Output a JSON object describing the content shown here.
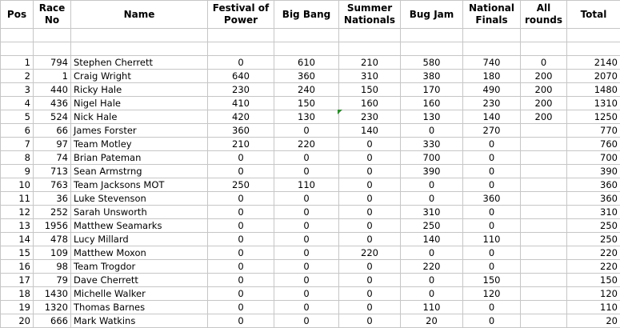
{
  "headers": {
    "pos": "Pos",
    "race_no": "Race No",
    "name": "Name",
    "festival_of_power": "Festival of Power",
    "big_bang": "Big Bang",
    "summer_nationals": "Summer Nationals",
    "bug_jam": "Bug Jam",
    "national_finals": "National Finals",
    "all_rounds": "All rounds",
    "total": "Total"
  },
  "rows": [
    {
      "pos": "1",
      "race_no": "794",
      "name": "Stephen Cherrett",
      "festival_of_power": "0",
      "big_bang": "610",
      "summer_nationals": "210",
      "bug_jam": "580",
      "national_finals": "740",
      "all_rounds": "0",
      "total": "2140"
    },
    {
      "pos": "2",
      "race_no": "1",
      "name": "Craig Wright",
      "festival_of_power": "640",
      "big_bang": "360",
      "summer_nationals": "310",
      "bug_jam": "380",
      "national_finals": "180",
      "all_rounds": "200",
      "total": "2070"
    },
    {
      "pos": "3",
      "race_no": "440",
      "name": "Ricky Hale",
      "festival_of_power": "230",
      "big_bang": "240",
      "summer_nationals": "150",
      "bug_jam": "170",
      "national_finals": "490",
      "all_rounds": "200",
      "total": "1480"
    },
    {
      "pos": "4",
      "race_no": "436",
      "name": "Nigel Hale",
      "festival_of_power": "410",
      "big_bang": "150",
      "summer_nationals": "160",
      "bug_jam": "160",
      "national_finals": "230",
      "all_rounds": "200",
      "total": "1310"
    },
    {
      "pos": "5",
      "race_no": "524",
      "name": "Nick Hale",
      "festival_of_power": "420",
      "big_bang": "130",
      "summer_nationals": "230",
      "bug_jam": "130",
      "national_finals": "140",
      "all_rounds": "200",
      "total": "1250"
    },
    {
      "pos": "6",
      "race_no": "66",
      "name": "James Forster",
      "festival_of_power": "360",
      "big_bang": "0",
      "summer_nationals": "140",
      "bug_jam": "0",
      "national_finals": "270",
      "all_rounds": "",
      "total": "770"
    },
    {
      "pos": "7",
      "race_no": "97",
      "name": "Team Motley",
      "festival_of_power": "210",
      "big_bang": "220",
      "summer_nationals": "0",
      "bug_jam": "330",
      "national_finals": "0",
      "all_rounds": "",
      "total": "760"
    },
    {
      "pos": "8",
      "race_no": "74",
      "name": "Brian Pateman",
      "festival_of_power": "0",
      "big_bang": "0",
      "summer_nationals": "0",
      "bug_jam": "700",
      "national_finals": "0",
      "all_rounds": "",
      "total": "700"
    },
    {
      "pos": "9",
      "race_no": "713",
      "name": "Sean Armstrng",
      "festival_of_power": "0",
      "big_bang": "0",
      "summer_nationals": "0",
      "bug_jam": "390",
      "national_finals": "0",
      "all_rounds": "",
      "total": "390"
    },
    {
      "pos": "10",
      "race_no": "763",
      "name": "Team Jacksons MOT",
      "festival_of_power": "250",
      "big_bang": "110",
      "summer_nationals": "0",
      "bug_jam": "0",
      "national_finals": "0",
      "all_rounds": "",
      "total": "360"
    },
    {
      "pos": "11",
      "race_no": "36",
      "name": "Luke Stevenson",
      "festival_of_power": "0",
      "big_bang": "0",
      "summer_nationals": "0",
      "bug_jam": "0",
      "national_finals": "360",
      "all_rounds": "",
      "total": "360"
    },
    {
      "pos": "12",
      "race_no": "252",
      "name": "Sarah Unsworth",
      "festival_of_power": "0",
      "big_bang": "0",
      "summer_nationals": "0",
      "bug_jam": "310",
      "national_finals": "0",
      "all_rounds": "",
      "total": "310"
    },
    {
      "pos": "13",
      "race_no": "1956",
      "name": "Matthew Seamarks",
      "festival_of_power": "0",
      "big_bang": "0",
      "summer_nationals": "0",
      "bug_jam": "250",
      "national_finals": "0",
      "all_rounds": "",
      "total": "250"
    },
    {
      "pos": "14",
      "race_no": "478",
      "name": "Lucy Millard",
      "festival_of_power": "0",
      "big_bang": "0",
      "summer_nationals": "0",
      "bug_jam": "140",
      "national_finals": "110",
      "all_rounds": "",
      "total": "250"
    },
    {
      "pos": "15",
      "race_no": "109",
      "name": "Matthew Moxon",
      "festival_of_power": "0",
      "big_bang": "0",
      "summer_nationals": "220",
      "bug_jam": "0",
      "national_finals": "0",
      "all_rounds": "",
      "total": "220"
    },
    {
      "pos": "16",
      "race_no": "98",
      "name": "Team Trogdor",
      "festival_of_power": "0",
      "big_bang": "0",
      "summer_nationals": "0",
      "bug_jam": "220",
      "national_finals": "0",
      "all_rounds": "",
      "total": "220"
    },
    {
      "pos": "17",
      "race_no": "79",
      "name": "Dave Cherrett",
      "festival_of_power": "0",
      "big_bang": "0",
      "summer_nationals": "0",
      "bug_jam": "0",
      "national_finals": "150",
      "all_rounds": "",
      "total": "150"
    },
    {
      "pos": "18",
      "race_no": "1430",
      "name": "Michelle Walker",
      "festival_of_power": "0",
      "big_bang": "0",
      "summer_nationals": "0",
      "bug_jam": "0",
      "national_finals": "120",
      "all_rounds": "",
      "total": "120"
    },
    {
      "pos": "19",
      "race_no": "1320",
      "name": "Thomas Barnes",
      "festival_of_power": "0",
      "big_bang": "0",
      "summer_nationals": "0",
      "bug_jam": "110",
      "national_finals": "0",
      "all_rounds": "",
      "total": "110"
    },
    {
      "pos": "20",
      "race_no": "666",
      "name": "Mark Watkins",
      "festival_of_power": "0",
      "big_bang": "0",
      "summer_nationals": "0",
      "bug_jam": "20",
      "national_finals": "0",
      "all_rounds": "",
      "total": "20"
    }
  ],
  "colors": {
    "grid": "#c6c6c6",
    "comment_marker": "#2e8b2e"
  }
}
